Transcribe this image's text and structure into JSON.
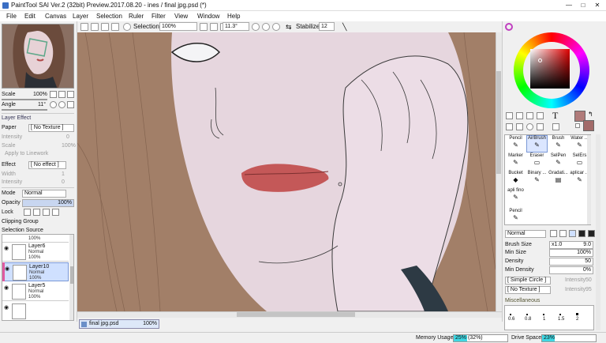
{
  "window": {
    "title": "PaintTool SAI Ver.2 (32bit) Preview.2017.08.20 - ines / final jpg.psd (*)",
    "minimize": "—",
    "maximize": "□",
    "close": "✕"
  },
  "menu": [
    "File",
    "Edit",
    "Canvas",
    "Layer",
    "Selection",
    "Ruler",
    "Filter",
    "View",
    "Window",
    "Help"
  ],
  "toolbar": {
    "selection_label": "Selection",
    "zoom": "100%",
    "angle": "11.3°",
    "stabilizer_label": "Stabilizer",
    "stabilizer_value": "12"
  },
  "left": {
    "scale_label": "Scale",
    "scale_value": "100%",
    "angle_label": "Angle",
    "angle_value": "11°",
    "layer_effect_header": "Layer Effect",
    "paper_label": "Paper",
    "paper_value": "[ No Texture ]",
    "intensity_label": "Intensity",
    "intensity_value": "0",
    "scale2_label": "Scale",
    "scale2_value": "100%",
    "apply_linework": "Apply to Linework",
    "effect_label": "Effect",
    "effect_value": "[ No effect ]",
    "width_label": "Width",
    "width_value": "1",
    "intensity2_label": "Intensity",
    "intensity2_value": "0",
    "mode_label": "Mode",
    "mode_value": "Normal",
    "opacity_label": "Opacity",
    "opacity_value": "100%",
    "opacity_fill": 1.0,
    "lock_label": "Lock",
    "clipping_group": "Clipping Group",
    "selection_source": "Selection Source",
    "layers": [
      {
        "name": "",
        "mode": "",
        "opacity": "100%"
      },
      {
        "name": "Layer6",
        "mode": "Normal",
        "opacity": "100%"
      },
      {
        "name": "Layer10",
        "mode": "Normal",
        "opacity": "100%"
      },
      {
        "name": "Layer5",
        "mode": "Normal",
        "opacity": "100%"
      }
    ]
  },
  "doc_tab": {
    "name": "final jpg.psd",
    "zoom": "100%"
  },
  "right": {
    "main_color": "#b07b7a",
    "sub_color": "#a26a69",
    "tools": [
      [
        "Pencil",
        "AirBrush",
        "Brush",
        "Water ..."
      ],
      [
        "Marker",
        "Eraser",
        "SelPen",
        "SelErs"
      ],
      [
        "Bucket",
        "Binary ...",
        "Gradati...",
        "aplicar ..."
      ],
      [
        "apli fino",
        "",
        "",
        ""
      ],
      [
        "Pencil",
        "",
        "",
        ""
      ]
    ],
    "blend_mode": "Normal",
    "brush_size_label": "Brush Size",
    "brush_size_mult": "x1.0",
    "brush_size_value": "9.0",
    "min_size_label": "Min Size",
    "min_size_value": "100%",
    "density_label": "Density",
    "density_value": "50",
    "min_density_label": "Min Density",
    "min_density_value": "0%",
    "shape_value": "[ Simple Circle ]",
    "shape_intensity_label": "Intensity",
    "shape_intensity_value": "50",
    "texture_value": "[ No Texture ]",
    "texture_intensity_label": "Intensity",
    "texture_intensity_value": "95",
    "misc_label": "Miscellaneous",
    "size_presets": [
      "0.6",
      "0.8",
      "1",
      "1.5",
      "2"
    ]
  },
  "status": {
    "memory_label": "Memory Usage",
    "memory_value": "25% (32%)",
    "memory_fill": 0.25,
    "drive_label": "Drive Space",
    "drive_value": "23%",
    "drive_fill": 0.23
  }
}
